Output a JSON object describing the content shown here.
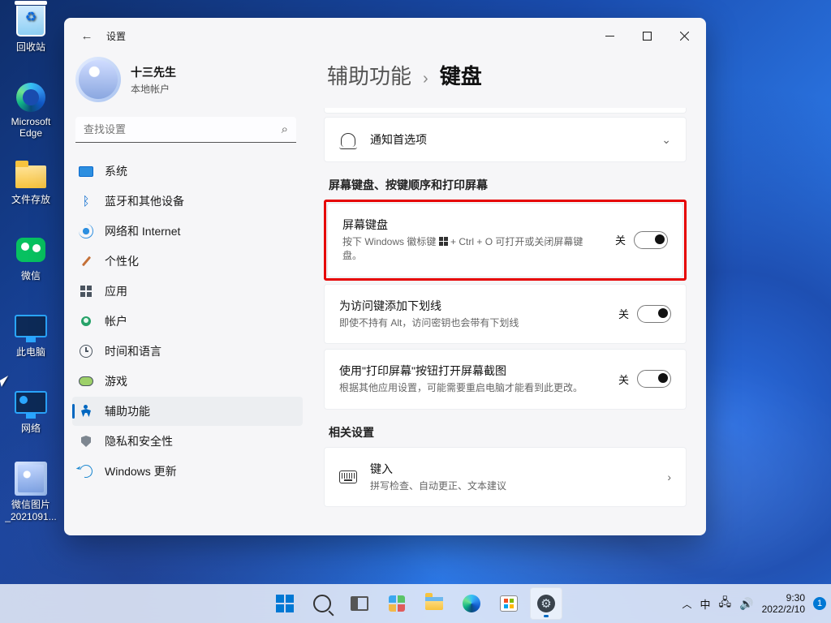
{
  "desktop": {
    "icons": [
      {
        "label": "回收站"
      },
      {
        "label": "Microsoft Edge"
      },
      {
        "label": "文件存放"
      },
      {
        "label": "微信"
      },
      {
        "label": "此电脑"
      },
      {
        "label": "网络"
      },
      {
        "label": "微信图片_2021091..."
      }
    ]
  },
  "window": {
    "title": "设置",
    "back_aria": "返回"
  },
  "profile": {
    "name": "十三先生",
    "sub": "本地帐户"
  },
  "search": {
    "placeholder": "查找设置"
  },
  "nav": [
    {
      "label": "系统"
    },
    {
      "label": "蓝牙和其他设备"
    },
    {
      "label": "网络和 Internet"
    },
    {
      "label": "个性化"
    },
    {
      "label": "应用"
    },
    {
      "label": "帐户"
    },
    {
      "label": "时间和语言"
    },
    {
      "label": "游戏"
    },
    {
      "label": "辅助功能"
    },
    {
      "label": "隐私和安全性"
    },
    {
      "label": "Windows 更新"
    }
  ],
  "breadcrumb": {
    "parent": "辅助功能",
    "sep": "›",
    "current": "键盘"
  },
  "notif": {
    "title": "通知首选项"
  },
  "section1_header": "屏幕键盘、按键顺序和打印屏幕",
  "toggles": {
    "osk": {
      "title": "屏幕键盘",
      "sub_a": "按下 Windows 徽标键 ",
      "sub_b": " + Ctrl + O 可打开或关闭屏幕键盘。",
      "state": "关"
    },
    "underline": {
      "title": "为访问键添加下划线",
      "sub": "即使不持有 Alt，访问密钥也会带有下划线",
      "state": "关"
    },
    "printscreen": {
      "title": "使用\"打印屏幕\"按钮打开屏幕截图",
      "sub": "根据其他应用设置，可能需要重启电脑才能看到此更改。",
      "state": "关"
    }
  },
  "related_header": "相关设置",
  "typing": {
    "title": "键入",
    "sub": "拼写检查、自动更正、文本建议"
  },
  "tray": {
    "ime": "中",
    "time": "9:30",
    "date": "2022/2/10",
    "badge": "1"
  }
}
